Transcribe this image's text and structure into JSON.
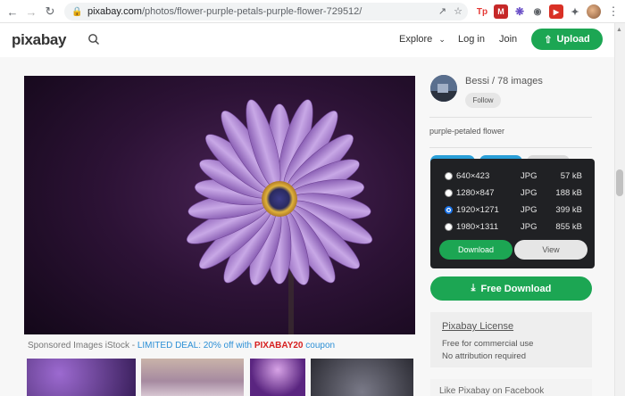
{
  "browser": {
    "url_host": "pixabay.com",
    "url_path": "/photos/flower-purple-petals-purple-flower-729512/",
    "ext_tp": "Tp",
    "ext_gm": "M"
  },
  "header": {
    "logo": "pixabay",
    "explore": "Explore",
    "login": "Log in",
    "join": "Join",
    "upload": "Upload"
  },
  "author": {
    "name_count": "Bessi / 78 images",
    "follow": "Follow"
  },
  "photo": {
    "description": "purple-petaled flower"
  },
  "sponsor": {
    "prefix": "Sponsored Images iStock - ",
    "deal": "LIMITED DEAL: 20% off with ",
    "code": "PIXABAY20",
    "suffix": " coupon"
  },
  "download_options": [
    {
      "dimensions": "640×423",
      "format": "JPG",
      "size": "57 kB",
      "selected": false
    },
    {
      "dimensions": "1280×847",
      "format": "JPG",
      "size": "188 kB",
      "selected": false
    },
    {
      "dimensions": "1920×1271",
      "format": "JPG",
      "size": "399 kB",
      "selected": true
    },
    {
      "dimensions": "1980×1311",
      "format": "JPG",
      "size": "855 kB",
      "selected": false
    }
  ],
  "dropdown": {
    "download": "Download",
    "view": "View"
  },
  "free_download": "Free Download",
  "license": {
    "title": "Pixabay License",
    "line1": "Free for commercial use",
    "line2": "No attribution required"
  },
  "facebook": "Like Pixabay on Facebook",
  "colors": {
    "accent_green": "#1ca653",
    "dropdown_bg": "#202124",
    "tag_blue": "#2a9fd8"
  }
}
